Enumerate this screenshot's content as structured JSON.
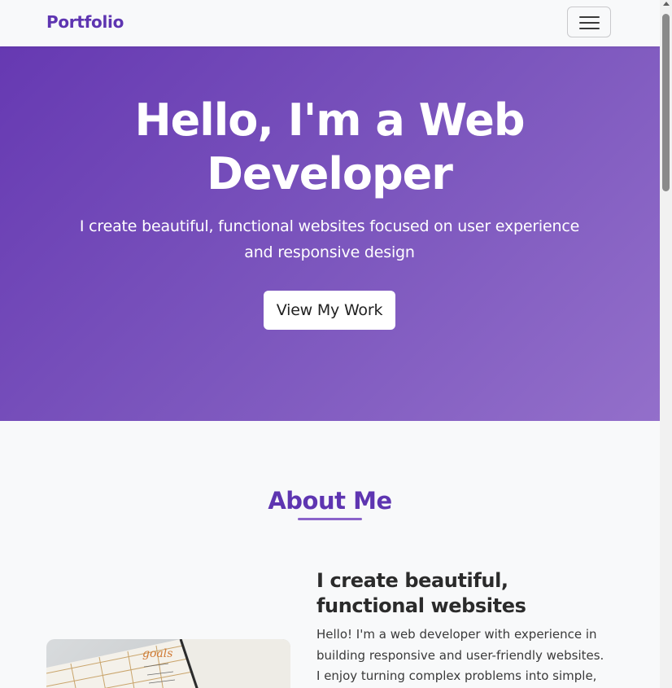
{
  "navbar": {
    "brand": "Portfolio",
    "toggler_icon": "hamburger-menu-icon"
  },
  "hero": {
    "title": "Hello, I'm a Web Developer",
    "subtitle": "I create beautiful, functional websites focused on user experience and responsive design",
    "cta_label": "View My Work"
  },
  "about": {
    "title": "About Me",
    "heading": "I create beautiful, functional websites",
    "text": "Hello! I'm a web developer with experience in building responsive and user-friendly websites. I enjoy turning complex problems into simple,",
    "image_icon": "notebook-photo"
  },
  "colors": {
    "brand": "#5e35b1",
    "hero_gradient_start": "#6639b2",
    "hero_gradient_end": "#936fca",
    "accent_underline": "#8a63c9"
  }
}
